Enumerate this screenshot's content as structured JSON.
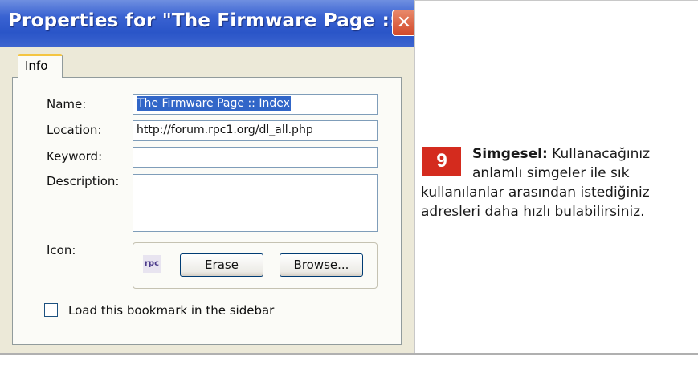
{
  "dialog": {
    "title": "Properties for \"The Firmware Page :: Index\"",
    "close_icon": "close-icon",
    "tab_label": "Info",
    "fields": {
      "name_label": "Name:",
      "name_value": "The Firmware Page :: Index",
      "location_label": "Location:",
      "location_value": "http://forum.rpc1.org/dl_all.php",
      "keyword_label": "Keyword:",
      "keyword_value": "",
      "description_label": "Description:",
      "description_value": ""
    },
    "icon_section": {
      "label": "Icon:",
      "icon_text": "rpc",
      "erase_label": "Erase",
      "browse_label": "Browse..."
    },
    "sidebar_checkbox": {
      "label": "Load this bookmark in the sidebar",
      "checked": false
    }
  },
  "caption": {
    "badge_number": "9",
    "bold_term": "Simgesel:",
    "line1_rest": " Kullanacağınız",
    "line2": "anlamlı simgeler ile sık",
    "line3": "kullanılanlar arasından istediğiniz",
    "line4": "adresleri daha hızlı bulabilirsiniz.",
    "badge_color": "#d42b1e"
  }
}
